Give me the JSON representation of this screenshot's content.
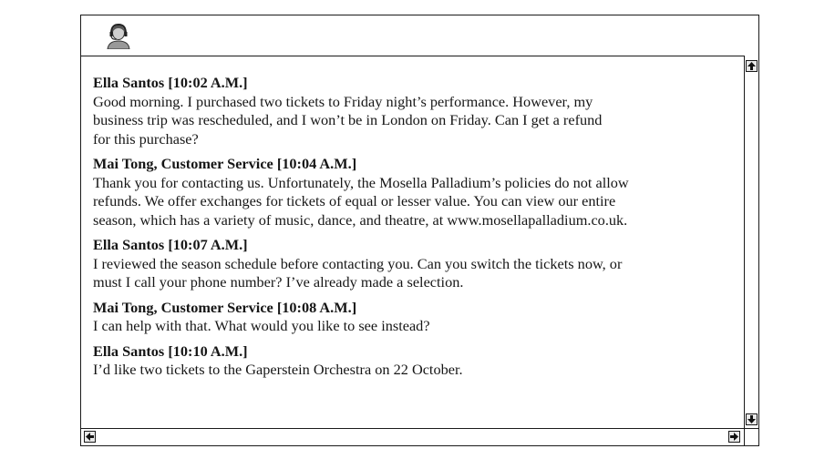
{
  "messages": [
    {
      "sender": "Ella Santos [10:02 A.M.]",
      "lines": [
        "Good morning. I purchased two tickets to Friday night’s performance. However, my",
        "business trip was rescheduled, and I won’t be in London on Friday. Can I get a refund",
        "for this purchase?"
      ]
    },
    {
      "sender": "Mai Tong, Customer Service [10:04 A.M.]",
      "lines": [
        "Thank you for contacting us. Unfortunately, the Mosella Palladium’s policies do not allow",
        "refunds. We offer exchanges for tickets of equal or lesser value. You can view our entire",
        "season, which has a variety of music, dance, and theatre, at www.mosellapalladium.co.uk."
      ]
    },
    {
      "sender": "Ella Santos [10:07 A.M.]",
      "lines": [
        "I reviewed the season schedule before contacting you. Can you switch the tickets now, or",
        "must I call your phone number? I’ve already made a selection."
      ]
    },
    {
      "sender": "Mai Tong, Customer Service [10:08 A.M.]",
      "lines": [
        "I can help with that. What would you like to see instead?"
      ]
    },
    {
      "sender": "Ella Santos [10:10 A.M.]",
      "lines": [
        "I’d like two tickets to the Gaperstein Orchestra on 22 October."
      ]
    }
  ],
  "icons": {
    "avatar": "headset-agent-icon",
    "scroll_up": "arrow-up-icon",
    "scroll_down": "arrow-down-icon",
    "scroll_left": "arrow-left-icon",
    "scroll_right": "arrow-right-icon"
  },
  "colors": {
    "border": "#1a1a1a",
    "text": "#161616",
    "background": "#ffffff"
  }
}
